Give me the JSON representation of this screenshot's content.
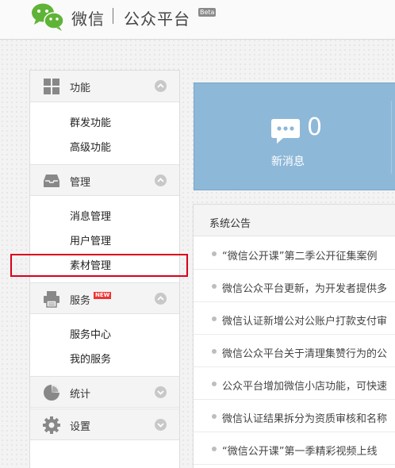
{
  "header": {
    "brand": "微信",
    "subtitle": "公众平台",
    "beta": "Beta"
  },
  "sidebar": {
    "sections": [
      {
        "title": "功能",
        "icon": "grid-icon",
        "items": [
          "群发功能",
          "高级功能"
        ]
      },
      {
        "title": "管理",
        "icon": "inbox-icon",
        "items": [
          "消息管理",
          "用户管理",
          "素材管理"
        ]
      },
      {
        "title": "服务",
        "icon": "printer-icon",
        "badge": "NEW",
        "items": [
          "服务中心",
          "我的服务"
        ]
      },
      {
        "title": "统计",
        "icon": "pie-chart-icon",
        "items": []
      },
      {
        "title": "设置",
        "icon": "gear-icon",
        "items": []
      }
    ]
  },
  "stats": {
    "new_messages_count": "0",
    "new_messages_label": "新消息"
  },
  "notice": {
    "title": "系统公告",
    "items": [
      "“微信公开课”第二季公开征集案例",
      "微信公众平台更新，为开发者提供多",
      "微信认证新增公对公账户打款支付审",
      "微信公众平台关于清理集赞行为的公",
      "公众平台增加微信小店功能，可快速",
      "微信认证结果拆分为资质审核和名称",
      "“微信公开课”第一季精彩视频上线"
    ]
  },
  "colors": {
    "stat_box": "#8eb8d8",
    "highlight": "#d9001b",
    "logo_green": "#5fb336"
  }
}
